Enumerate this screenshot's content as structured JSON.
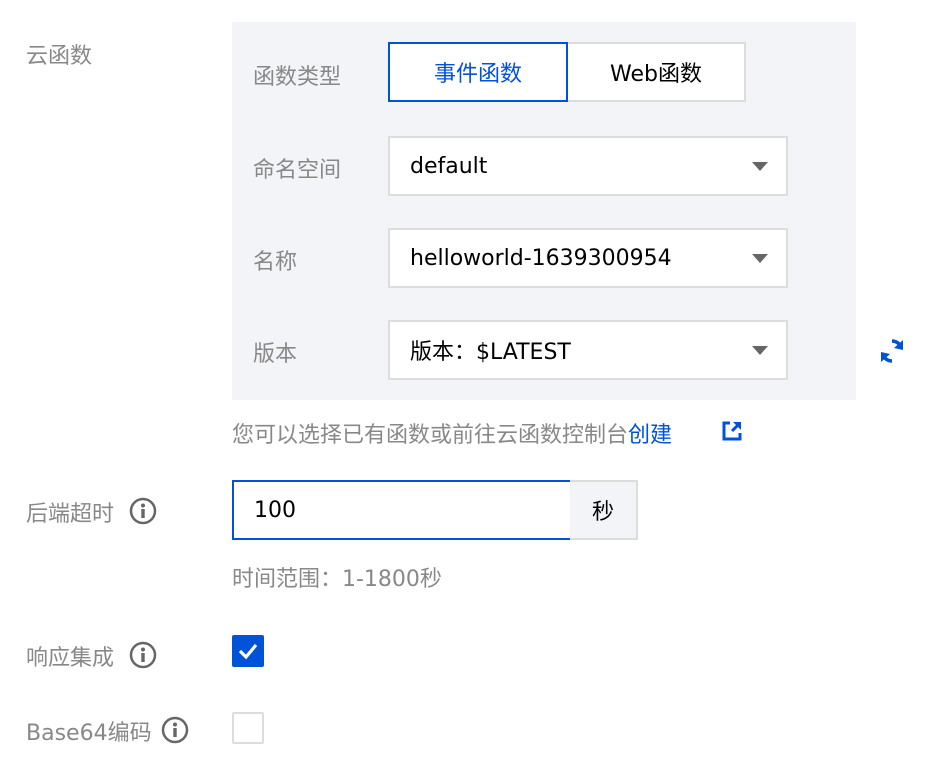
{
  "cloud_function": {
    "label": "云函数",
    "type_label": "函数类型",
    "type_options": [
      "事件函数",
      "Web函数"
    ],
    "selected_type": "事件函数",
    "namespace_label": "命名空间",
    "namespace_value": "default",
    "name_label": "名称",
    "name_value": "helloworld-1639300954",
    "version_label": "版本",
    "version_value": "版本：$LATEST",
    "hint_text": "您可以选择已有函数或前往云函数控制台",
    "hint_link": "创建"
  },
  "timeout": {
    "label": "后端超时",
    "value": "100",
    "unit": "秒",
    "hint": "时间范围：1-1800秒"
  },
  "response_integration": {
    "label": "响应集成",
    "checked": true
  },
  "base64": {
    "label": "Base64编码",
    "checked": false
  },
  "colors": {
    "accent": "#0052d9",
    "label": "#888888",
    "panel_bg": "#f3f4f7",
    "border": "#dcdcdc"
  },
  "icons": [
    "info-icon",
    "refresh-icon",
    "external-link-icon",
    "check-icon",
    "caret-down-icon"
  ]
}
